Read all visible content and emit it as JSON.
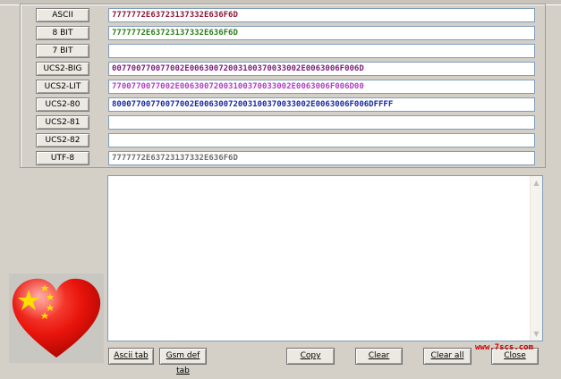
{
  "encodings": [
    {
      "label": "ASCII",
      "value": "7777772E63723137332E636F6D",
      "color": "#8b1a3a"
    },
    {
      "label": "8 BIT",
      "value": "7777772E63723137332E636F6D",
      "color": "#2e7d1e"
    },
    {
      "label": "7 BIT",
      "value": "",
      "color": "#000000"
    },
    {
      "label": "UCS2-BIG",
      "value": "007700770077002E00630072003100370033002E0063006F006D",
      "color": "#7a1f7a"
    },
    {
      "label": "UCS2-LIT",
      "value": "7700770077002E00630072003100370033002E0063006F006D00",
      "color": "#b040c0"
    },
    {
      "label": "UCS2-80",
      "value": "80007700770077002E00630072003100370033002E0063006F006DFFFF",
      "color": "#1a2aa0"
    },
    {
      "label": "UCS2-81",
      "value": "",
      "color": "#000000"
    },
    {
      "label": "UCS2-82",
      "value": "",
      "color": "#000000"
    },
    {
      "label": "UTF-8",
      "value": "7777772E63723137332E636F6D",
      "color": "#707070"
    }
  ],
  "buttons": {
    "ascii_tab": "Ascii tab",
    "gsm_def_tab": "Gsm def tab",
    "copy": "Copy",
    "clear": "Clear",
    "clear_all": "Clear all",
    "close": "Close"
  },
  "watermark": "www.7scs.com",
  "icons": {
    "heart_flag": "china-flag-heart-icon",
    "scroll_up": "scroll-up-arrow-icon",
    "scroll_down": "scroll-down-arrow-icon"
  }
}
